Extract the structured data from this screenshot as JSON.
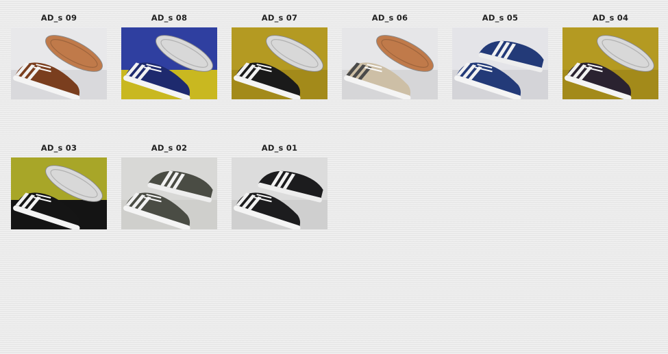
{
  "gallery": {
    "items": [
      {
        "caption": "AD_s 09",
        "icon": "brown-shoe-photo",
        "bg": "#e8e8ea",
        "floor": "#d9d9dc",
        "upper": "#7a3e1e",
        "stripe": "#f2f2f2",
        "sole": "#c07a4a",
        "soleTop": true
      },
      {
        "caption": "AD_s 08",
        "icon": "navy-shoe-photo",
        "bg": "#2f3fa0",
        "floor": "#c9b820",
        "upper": "#1e2a6e",
        "stripe": "#f2f2f2",
        "sole": "#d8d8d8",
        "soleTop": true
      },
      {
        "caption": "AD_s 07",
        "icon": "black-shoe-photo",
        "bg": "#b49a22",
        "floor": "#a38a1a",
        "upper": "#1a1a1a",
        "stripe": "#f2f2f2",
        "sole": "#d8d8d8",
        "soleTop": true
      },
      {
        "caption": "AD_s 06",
        "icon": "beige-shoe-photo",
        "bg": "#e6e6e8",
        "floor": "#d6d6d8",
        "upper": "#cdbfa6",
        "stripe": "#4a4a4a",
        "sole": "#c07a4a",
        "soleTop": true
      },
      {
        "caption": "AD_s 05",
        "icon": "blue-shoe-photo",
        "bg": "#e4e4e8",
        "floor": "#d4d4d8",
        "upper": "#233a78",
        "stripe": "#f2f2f2",
        "sole": "#eeeeee",
        "soleTop": false
      },
      {
        "caption": "AD_s 04",
        "icon": "dark-shoe-photo",
        "bg": "#b49a22",
        "floor": "#a38a1a",
        "upper": "#2a2230",
        "stripe": "#f2f2f2",
        "sole": "#d8d8d8",
        "soleTop": true
      },
      {
        "caption": "AD_s 03",
        "icon": "black-white-shoe-photo",
        "bg": "#a8a628",
        "floor": "#141414",
        "upper": "#151515",
        "stripe": "#f2f2f2",
        "sole": "#d8d8d8",
        "soleTop": true
      },
      {
        "caption": "AD_s 02",
        "icon": "olive-shoe-photo",
        "bg": "#d8d8d6",
        "floor": "#cfcfcc",
        "upper": "#4a4c44",
        "stripe": "#f2f2f2",
        "sole": "#eeeeee",
        "soleTop": false
      },
      {
        "caption": "AD_s 01",
        "icon": "black-suede-shoe-photo",
        "bg": "#dcdcdc",
        "floor": "#cfcfcf",
        "upper": "#1c1c1e",
        "stripe": "#f2f2f2",
        "sole": "#eeeeee",
        "soleTop": false
      }
    ]
  }
}
